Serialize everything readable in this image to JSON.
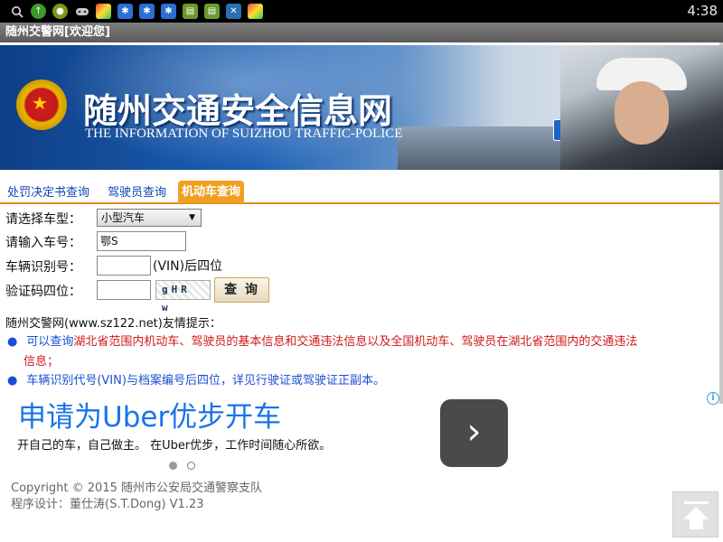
{
  "status_bar": {
    "time": "4:38",
    "icons": [
      "search-icon",
      "update-icon",
      "app-icon",
      "gamepad-icon",
      "browser-icon",
      "paw-icon",
      "paw-icon",
      "market-icon",
      "market-icon",
      "tools-icon",
      "browser-icon"
    ]
  },
  "window": {
    "title": "随州交警网[欢迎您]"
  },
  "banner": {
    "title_cn": "随州交通安全信息网",
    "title_en": "THE INFORMATION  OF  SUIZHOU TRAFFIC-POLICE"
  },
  "tabs": [
    {
      "label": "处罚决定书查询",
      "active": false
    },
    {
      "label": "驾驶员查询",
      "active": false
    },
    {
      "label": "机动车查询",
      "active": true
    }
  ],
  "form": {
    "vehicle_type_label": "请选择车型：",
    "vehicle_type_value": "小型汽车",
    "plate_label": "请输入车号：",
    "plate_value": "鄂S",
    "vin_label": "车辆识别号：",
    "vin_value": "",
    "vin_suffix": "(VIN)后四位",
    "captcha_label": "验证码四位：",
    "captcha_value": "",
    "captcha_image_text": "gHR w",
    "query_button": "查 询"
  },
  "tips": {
    "title": "随州交警网(www.sz122.net)友情提示：",
    "tip1_blue": "可以查询",
    "tip1_red": "湖北省范围内机动车、驾驶员的基本信息和交通违法信息以及全国机动车、驾驶员在湖北省范围内的交通违法",
    "tip1_red_cont": "信息；",
    "tip2": "车辆识别代号(VIN)与档案编号后四位，详见行驶证或驾驶证正副本。"
  },
  "ad": {
    "headline": "申请为Uber优步开车",
    "body": "开自己的车，自己做主。 在Uber优步，工作时间随心所欲。",
    "info": "i",
    "arrow": "›"
  },
  "footer": {
    "copyright": "Copyright © 2015 随州市公安局交通警察支队",
    "designer": "程序设计：董仕涛(S.T.Dong)  V1.23"
  },
  "colors": {
    "tab_active": "#f0a020",
    "tab_border": "#e38a1d",
    "link_blue": "#1044b3",
    "tip_red": "#d01818",
    "ad_blue": "#1a73e8"
  }
}
